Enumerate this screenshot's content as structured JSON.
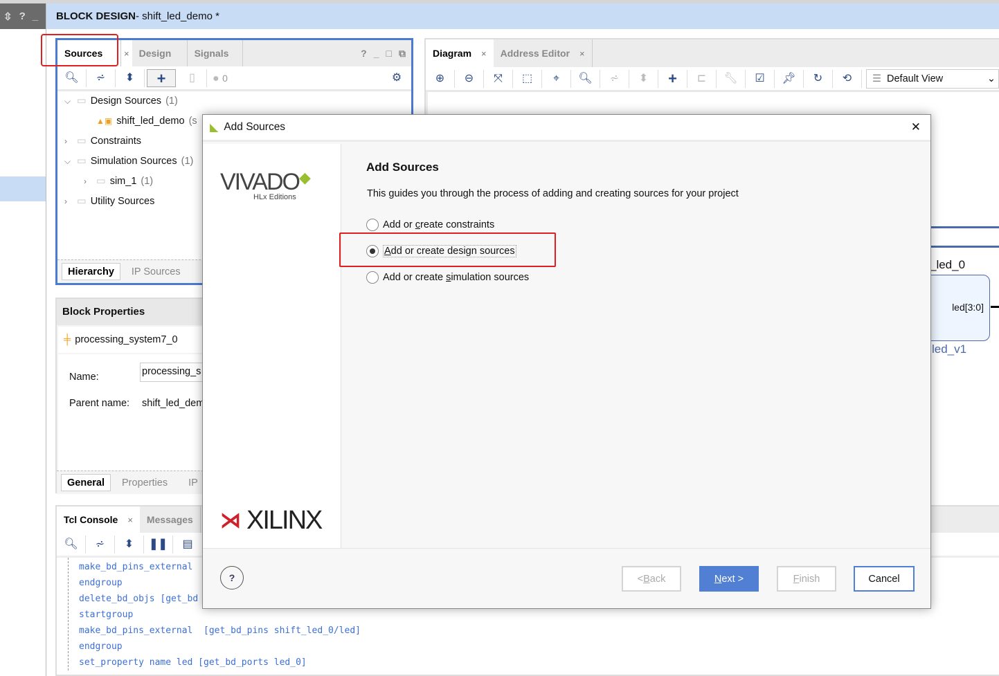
{
  "header": {
    "title_bold": "BLOCK DESIGN",
    "title_rest": " - shift_led_demo *"
  },
  "rail": {
    "icons": [
      "sort-icon",
      "help-icon",
      "minimize-icon"
    ],
    "labels": [
      "⇳",
      "?",
      "_"
    ]
  },
  "sources_panel": {
    "tabs": [
      {
        "label": "Sources",
        "active": true
      },
      {
        "label": "Design"
      },
      {
        "label": "Signals"
      }
    ],
    "close_glyph": "×",
    "window_controls": [
      "?",
      "_",
      "□",
      "⧉"
    ],
    "toolbar": {
      "icons": [
        "search-icon",
        "collapse-all-icon",
        "expand-all-icon",
        "add-icon",
        "unknown-file-icon",
        "status-dot-icon",
        "gear-icon"
      ],
      "count": "0"
    },
    "tree": [
      {
        "label": "Design Sources",
        "count": "(1)",
        "expanded": true,
        "level": 0
      },
      {
        "label": "shift_led_demo",
        "count": "(s",
        "level": 1
      },
      {
        "label": "Constraints",
        "count": "",
        "expanded": false,
        "level": 0
      },
      {
        "label": "Simulation Sources",
        "count": "(1)",
        "expanded": true,
        "level": 0
      },
      {
        "label": "sim_1",
        "count": "(1)",
        "expanded": false,
        "level": 1
      },
      {
        "label": "Utility Sources",
        "count": "",
        "expanded": false,
        "level": 0
      }
    ],
    "subtabs": [
      {
        "label": "Hierarchy",
        "active": true
      },
      {
        "label": "IP Sources"
      }
    ]
  },
  "block_properties": {
    "title": "Block Properties",
    "object": "processing_system7_0",
    "name_label": "Name:",
    "name_value": "processing_s",
    "parent_label": "Parent name:",
    "parent_value": "shift_led_dem",
    "subtabs": [
      {
        "label": "General",
        "active": true
      },
      {
        "label": "Properties"
      },
      {
        "label": "IP"
      }
    ]
  },
  "tcl_console": {
    "tabs": [
      {
        "label": "Tcl Console",
        "active": true
      },
      {
        "label": "Messages"
      }
    ],
    "toolbar_icons": [
      "search-icon",
      "collapse-all-icon",
      "expand-all-icon",
      "pause-icon",
      "clear-icon"
    ],
    "lines": [
      "make_bd_pins_external",
      "endgroup",
      "delete_bd_objs [get_bd",
      "startgroup",
      "make_bd_pins_external  [get_bd_pins shift_led_0/led]",
      "endgroup",
      "set_property name led [get_bd_ports led_0]"
    ]
  },
  "diagram_panel": {
    "tabs": [
      {
        "label": "Diagram",
        "active": true
      },
      {
        "label": "Address Editor"
      }
    ],
    "toolbar_icons": [
      "zoom-in-icon",
      "zoom-out-icon",
      "fit-icon",
      "select-area-icon",
      "center-icon",
      "search-icon",
      "collapse-icon",
      "expand-icon",
      "add-ip-icon",
      "route-icon",
      "wrench-icon",
      "validate-icon",
      "pin-icon",
      "refresh-icon",
      "regenerate-icon"
    ],
    "view_select": "Default View",
    "block": {
      "instance": "_led_0",
      "port": "led[3:0]",
      "type": "led_v1"
    }
  },
  "dialog": {
    "title": "Add Sources",
    "close_glyph": "✕",
    "logo_top": "VIVADO",
    "logo_sub": "HLx Editions",
    "logo_bottom": "XILINX",
    "heading": "Add Sources",
    "description": "This guides you through the process of adding and creating sources for your project",
    "options": [
      {
        "pre": "Add or ",
        "u": "c",
        "post": "reate constraints",
        "selected": false
      },
      {
        "pre": "",
        "u": "A",
        "post": "dd or create design sources",
        "selected": true
      },
      {
        "pre": "Add or create ",
        "u": "s",
        "post": "imulation sources",
        "selected": false
      }
    ],
    "help": "?",
    "buttons": {
      "back_pre": "< ",
      "back_u": "B",
      "back_post": "ack",
      "next_u": "N",
      "next_post": "ext >",
      "finish_u": "F",
      "finish_post": "inish",
      "cancel": "Cancel"
    },
    "colors": {
      "primary": "#517fd3",
      "highlight": "#e02020"
    }
  }
}
